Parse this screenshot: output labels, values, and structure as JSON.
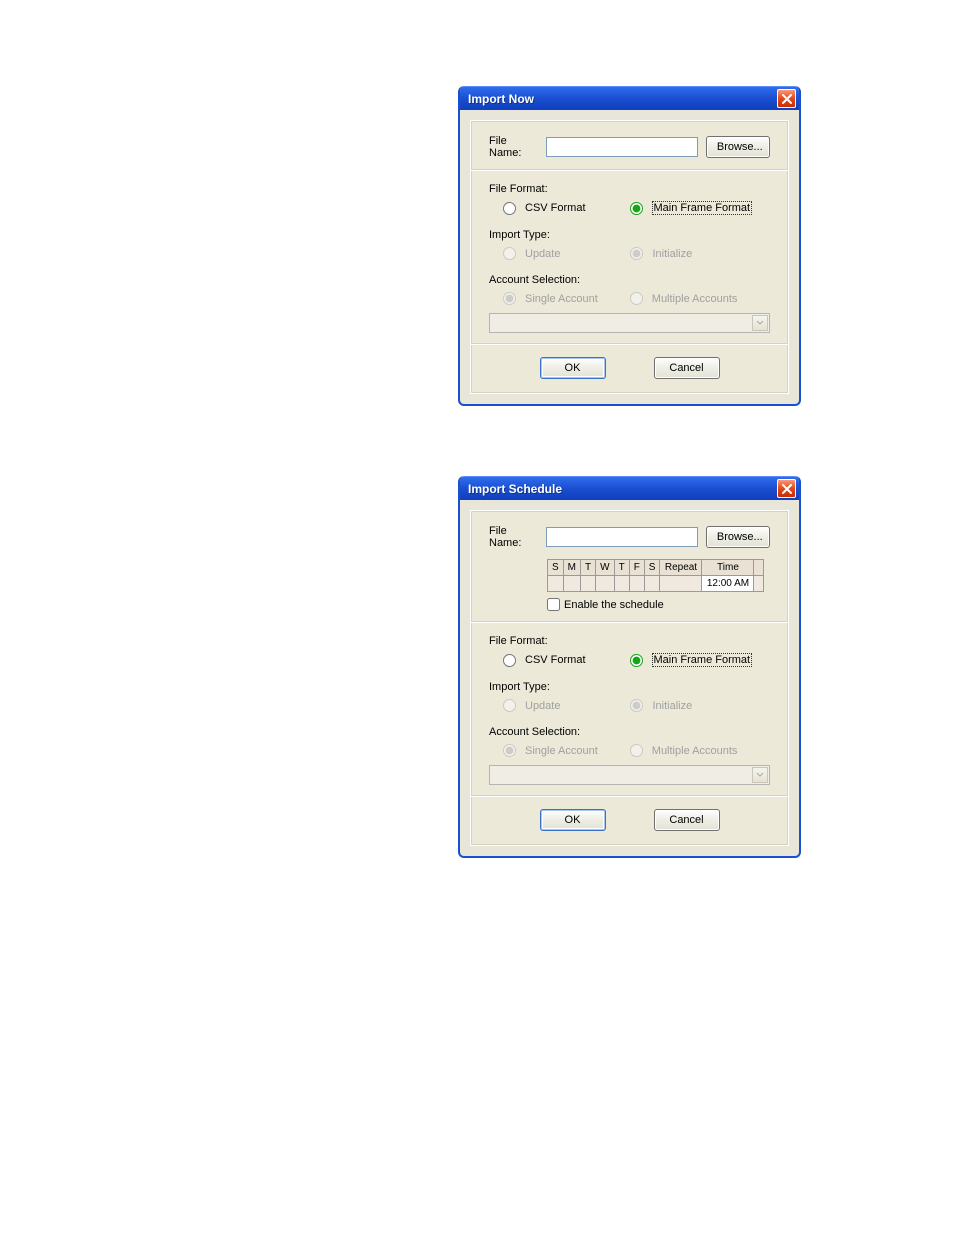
{
  "dialog1": {
    "title": "Import Now",
    "file_name_label": "File Name:",
    "file_name_value": "",
    "browse_label": "Browse...",
    "file_format_label": "File Format:",
    "csv_label": "CSV Format",
    "mainframe_label": "Main Frame Format",
    "import_type_label": "Import Type:",
    "update_label": "Update",
    "initialize_label": "Initialize",
    "account_sel_label": "Account Selection:",
    "single_label": "Single Account",
    "multiple_label": "Multiple Accounts",
    "ok_label": "OK",
    "cancel_label": "Cancel"
  },
  "dialog2": {
    "title": "Import Schedule",
    "file_name_label": "File Name:",
    "file_name_value": "",
    "browse_label": "Browse...",
    "schedule_days": [
      "S",
      "M",
      "T",
      "W",
      "T",
      "F",
      "S"
    ],
    "repeat_header": "Repeat",
    "time_header": "Time",
    "time_value": "12:00 AM",
    "enable_label": "Enable the schedule",
    "file_format_label": "File Format:",
    "csv_label": "CSV Format",
    "mainframe_label": "Main Frame Format",
    "import_type_label": "Import Type:",
    "update_label": "Update",
    "initialize_label": "Initialize",
    "account_sel_label": "Account Selection:",
    "single_label": "Single Account",
    "multiple_label": "Multiple Accounts",
    "ok_label": "OK",
    "cancel_label": "Cancel"
  }
}
